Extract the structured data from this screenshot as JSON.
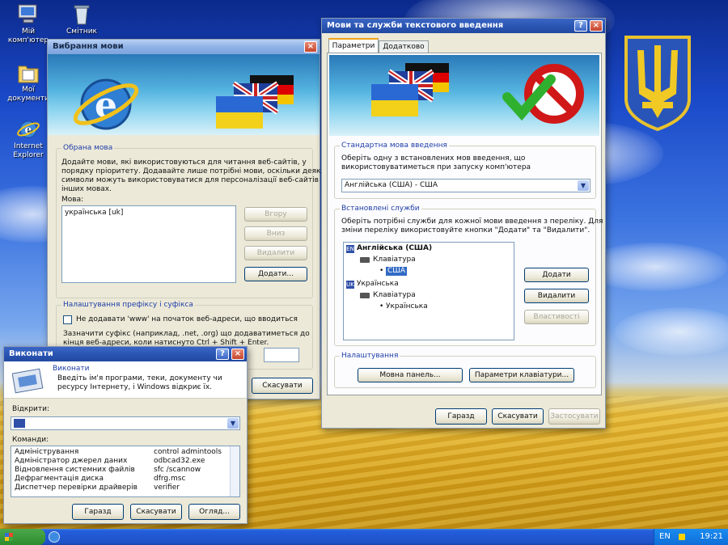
{
  "colors": {
    "accent": "#1f3ea8",
    "title_active": "#2a55b3",
    "title_inactive": "#8fb2e6",
    "taskbar": "#245edb"
  },
  "desktop": {
    "icons": [
      {
        "icon": "my-computer-icon",
        "label": "Мій комп'ютер"
      },
      {
        "icon": "recycle-bin-icon",
        "label": "Смітник"
      },
      {
        "icon": "my-documents-icon",
        "label": "Мої документи"
      },
      {
        "icon": "internet-explorer-icon",
        "label": "Internet Explorer"
      }
    ],
    "coat_of_arms": "ukraine-trident-icon"
  },
  "lang_window": {
    "title": "Вибрання мови",
    "group_title": "Обрана мова",
    "description": [
      "Додайте мови, які використовуються для читання веб-сайтів, у",
      "порядку пріоритету. Додавайте лише потрібні мови, оскільки деякі",
      "символи можуть використовуватися для персоналізації веб-сайтів",
      "інших мовах."
    ],
    "list_label": "Мова:",
    "list_items": [
      "українська [uk]"
    ],
    "buttons": {
      "up": "Вгору",
      "down": "Вниз",
      "remove": "Видалити",
      "add": "Додати..."
    },
    "prefix_title": "Налаштування префіксу і суфікса",
    "checkbox_label": "Не додавати 'www' на початок веб-адреси, що вводиться",
    "suffix_text": [
      "Зазначити суфікс (наприклад, .net, .org) що додаватиметься до",
      "кінця веб-адреси, коли натиснуто Ctrl + Shift + Enter."
    ],
    "suffix_value": "",
    "cancel": "Скасувати"
  },
  "services_window": {
    "title": "Мови та служби текстового введення",
    "tabs": [
      "Параметри",
      "Додатково"
    ],
    "default_group": "Стандартна мова введення",
    "default_desc": [
      "Оберіть одну з встановлених мов введення, що",
      "використовуватиметься при запуску комп'ютера"
    ],
    "default_value": "Англійська (США) - США",
    "installed_group": "Встановлені служби",
    "installed_desc": [
      "Оберіть потрібні служби для кожної мови введення з переліку. Для",
      "зміни переліку використовуйте кнопки \"Додати\" та \"Видалити\"."
    ],
    "tree": [
      {
        "level": 0,
        "icon": "en-lang-icon",
        "text": "Англійська (США)"
      },
      {
        "level": 1,
        "icon": "keyboard-icon",
        "text": "Клавіатура"
      },
      {
        "level": 2,
        "icon": "bullet",
        "text": "США"
      },
      {
        "level": 0,
        "icon": "uk-lang-icon",
        "text": "Українська"
      },
      {
        "level": 1,
        "icon": "keyboard-icon",
        "text": "Клавіатура"
      },
      {
        "level": 2,
        "icon": "bullet",
        "text": "Українська"
      }
    ],
    "side_buttons": {
      "add": "Додати",
      "remove": "Видалити",
      "properties": "Властивості"
    },
    "settings_group": "Налаштування",
    "lang_bar": "Мовна панель...",
    "key_settings": "Параметри клавіатури...",
    "ok": "Гаразд",
    "cancel": "Скасувати",
    "apply": "Застосувати"
  },
  "run_dialog": {
    "title": "Виконати",
    "header_title": "Виконати",
    "header_text": [
      "Введіть ім'я програми, теки, документу чи",
      "ресурсу Інтернету, і Windows відкриє їх."
    ],
    "open_label": "Відкрити:",
    "open_value": "",
    "commands_label": "Команди:",
    "commands": [
      {
        "name": "Адміністрування",
        "cmd": "control admintools"
      },
      {
        "name": "Адміністратор джерел даних",
        "cmd": "odbcad32.exe"
      },
      {
        "name": "Відновлення системних файлів",
        "cmd": "sfc /scannow"
      },
      {
        "name": "Дефрагментація диска",
        "cmd": "dfrg.msc"
      },
      {
        "name": "Диспетчер перевірки драйверів",
        "cmd": "verifier"
      }
    ],
    "ok": "Гаразд",
    "cancel": "Скасувати",
    "browse": "Огляд..."
  },
  "taskbar": {
    "clock": "19:21",
    "tray_lang": "EN"
  }
}
